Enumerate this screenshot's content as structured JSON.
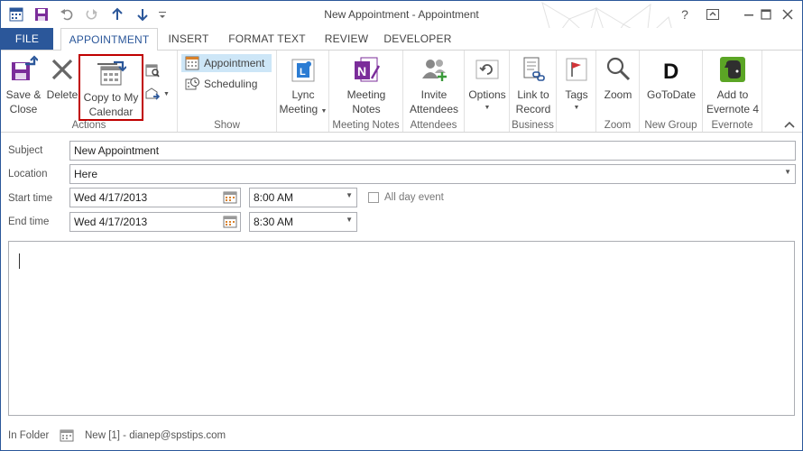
{
  "window": {
    "title": "New Appointment - Appointment",
    "help": "?",
    "restore": "⧉",
    "minimize": "—",
    "close": "✕"
  },
  "tabs": [
    {
      "label": "FILE"
    },
    {
      "label": "APPOINTMENT"
    },
    {
      "label": "INSERT"
    },
    {
      "label": "FORMAT TEXT"
    },
    {
      "label": "REVIEW"
    },
    {
      "label": "DEVELOPER"
    }
  ],
  "ribbon": {
    "actions": {
      "label": "Actions",
      "save_close_1": "Save &",
      "save_close_2": "Close",
      "delete": "Delete",
      "copy_1": "Copy to My",
      "copy_2": "Calendar"
    },
    "show": {
      "label": "Show",
      "appointment": "Appointment",
      "scheduling": "Scheduling"
    },
    "lync": {
      "label_1": "Lync",
      "label_2": "Meeting"
    },
    "meeting_notes": {
      "group_label": "Meeting Notes",
      "label_1": "Meeting",
      "label_2": "Notes"
    },
    "attendees": {
      "group_label": "Attendees",
      "label_1": "Invite",
      "label_2": "Attendees"
    },
    "options": {
      "label": "Options"
    },
    "business": {
      "group_label": "Business",
      "label_1": "Link to",
      "label_2": "Record"
    },
    "tags": {
      "label": "Tags"
    },
    "zoom": {
      "group_label": "Zoom",
      "label": "Zoom"
    },
    "new_group": {
      "group_label": "New Group",
      "label": "GoToDate"
    },
    "evernote": {
      "group_label": "Evernote",
      "label_1": "Add to",
      "label_2": "Evernote 4"
    }
  },
  "form": {
    "subject_label": "Subject",
    "subject_value": "New Appointment",
    "location_label": "Location",
    "location_value": "Here",
    "start_label": "Start time",
    "start_date": "Wed 4/17/2013",
    "start_time": "8:00 AM",
    "all_day_label": "All day event",
    "end_label": "End time",
    "end_date": "Wed 4/17/2013",
    "end_time": "8:30 AM"
  },
  "status": {
    "in_folder_label": "In Folder",
    "folder_value": "New [1] - dianep@spstips.com"
  },
  "colors": {
    "accent": "#2b579a",
    "highlight_box": "#c00000",
    "evernote_green": "#5ba525",
    "onenote_purple": "#7b2d9a",
    "show_selected": "#cde6f7"
  }
}
